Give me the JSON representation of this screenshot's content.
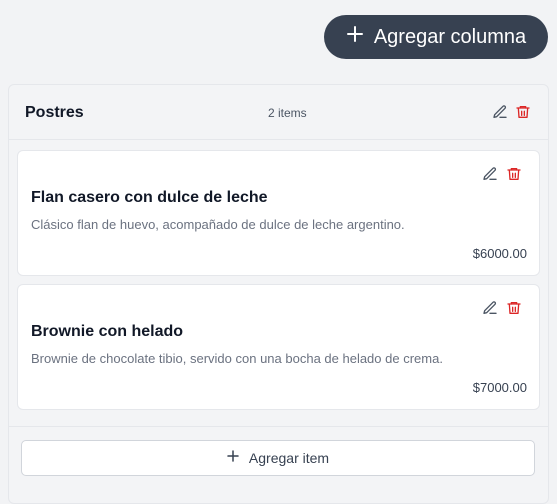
{
  "toolbar": {
    "add_column_label": "Agregar columna",
    "add_column_icon": "plus-icon"
  },
  "column": {
    "title": "Postres",
    "count": "2 items",
    "icons": [
      "edit-icon",
      "trash-icon"
    ],
    "add_item_label": "Agregar item",
    "items": [
      {
        "title": "Flan casero con dulce de leche",
        "description": "Clásico flan de huevo, acompañado de dulce de leche argentino.",
        "price": "$6000.00"
      },
      {
        "title": "Brownie con helado",
        "description": "Brownie de chocolate tibio, servido con una bocha de helado de crema.",
        "price": "$7000.00"
      }
    ]
  },
  "colors": {
    "primary_button": "#374151",
    "delete_red": "#dc2626",
    "edit_gray": "#4b5563"
  }
}
